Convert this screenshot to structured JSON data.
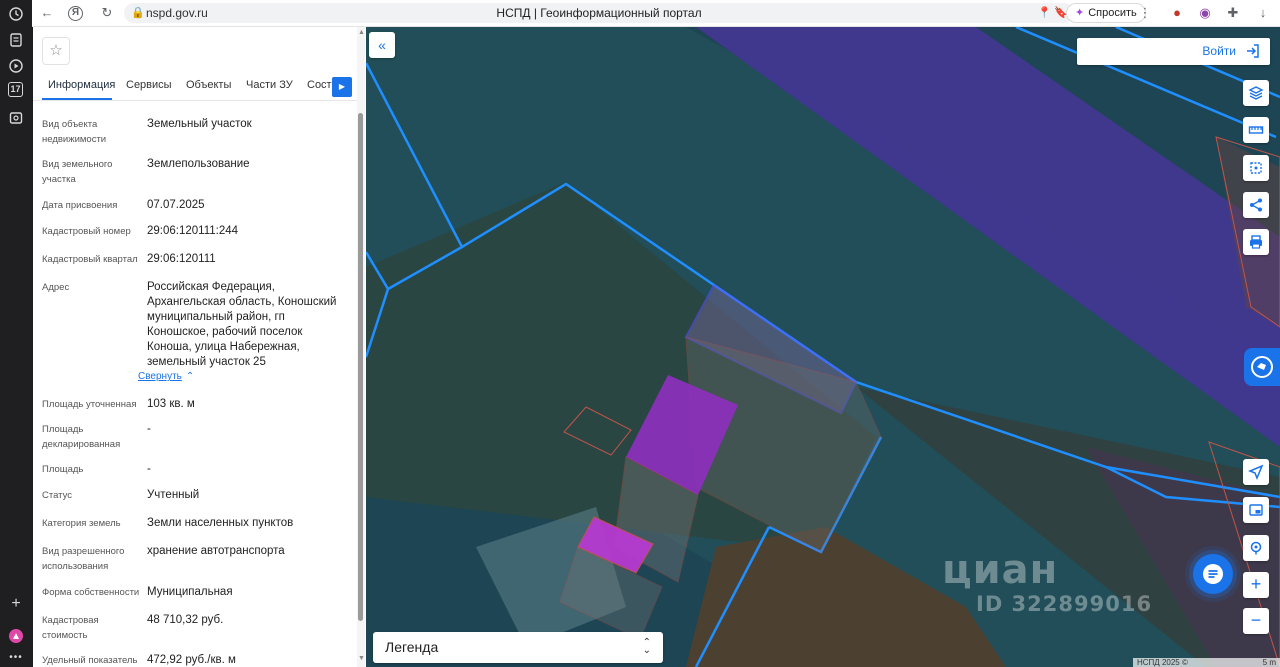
{
  "browser": {
    "url": "nspd.gov.ru",
    "tab_title": "НСПД | Геоинформационный портал",
    "ask_label": "Спросить",
    "rail_badge": "17"
  },
  "panel": {
    "tabs": [
      {
        "label": "Информация"
      },
      {
        "label": "Сервисы"
      },
      {
        "label": "Объекты"
      },
      {
        "label": "Части ЗУ"
      },
      {
        "label": "Соста"
      }
    ],
    "fields": [
      {
        "label": "Вид объекта недвижимости",
        "value": "Земельный участок"
      },
      {
        "label": "Вид земельного участка",
        "value": "Землепользование"
      },
      {
        "label": "Дата присвоения",
        "value": "07.07.2025"
      },
      {
        "label": "Кадастровый номер",
        "value": "29:06:120111:244"
      },
      {
        "label": "Кадастровый квартал",
        "value": "29:06:120111"
      },
      {
        "label": "Адрес",
        "value": "Российская Федерация, Архангельская область, Коношский муниципальный район, гп Коношское, рабочий поселок Коноша, улица Набережная, земельный участок 25"
      },
      {
        "label": "Площадь уточненная",
        "value": "103 кв. м"
      },
      {
        "label": "Площадь декларированная",
        "value": "-"
      },
      {
        "label": "Площадь",
        "value": "-"
      },
      {
        "label": "Статус",
        "value": "Учтенный"
      },
      {
        "label": "Категория земель",
        "value": "Земли населенных пунктов"
      },
      {
        "label": "Вид разрешенного использования",
        "value": "хранение автотранспорта"
      },
      {
        "label": "Форма собственности",
        "value": "Муниципальная"
      },
      {
        "label": "Кадастровая стоимость",
        "value": "48 710,32 руб."
      },
      {
        "label": "Удельный показатель",
        "value": "472,92 руб./кв. м"
      }
    ],
    "collapse_label": "Свернуть"
  },
  "map": {
    "login_label": "Войти",
    "legend_label": "Легенда",
    "watermark_brand": "циан",
    "watermark_id": "ID 322899016",
    "attribution": "НСПД 2025 ©",
    "scale": "5 m"
  }
}
